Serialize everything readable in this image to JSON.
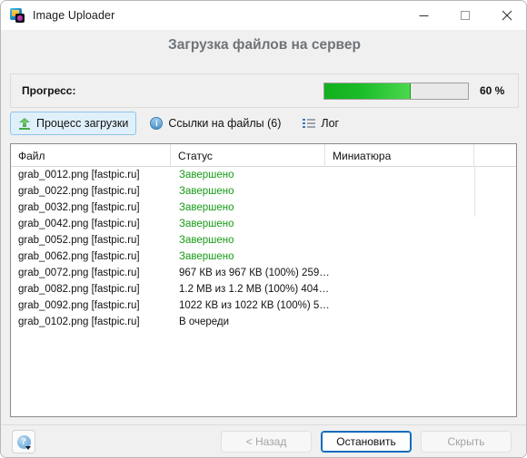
{
  "window": {
    "title": "Image Uploader",
    "icon": "app-icon",
    "controls": {
      "minimize": "minimize-icon",
      "maximize": "maximize-icon",
      "close": "close-icon"
    }
  },
  "heading": "Загрузка файлов на сервер",
  "progress": {
    "label": "Прогресс:",
    "percent_text": "60 %",
    "percent_value": 60,
    "fill_color": "#19bb26",
    "track_color": "#e9e9e9"
  },
  "tabs": [
    {
      "label": "Процесс загрузки",
      "icon": "upload-arrow-icon",
      "active": true
    },
    {
      "label": "Ссылки на файлы (6)",
      "icon": "info-circle-icon",
      "active": false
    },
    {
      "label": "Лог",
      "icon": "list-icon",
      "active": false
    }
  ],
  "table": {
    "columns": [
      "Файл",
      "Статус",
      "Миниатюра",
      ""
    ],
    "rows": [
      {
        "file": "grab_0012.png [fastpic.ru]",
        "status": "Завершено",
        "done": true,
        "thumb": ""
      },
      {
        "file": "grab_0022.png [fastpic.ru]",
        "status": "Завершено",
        "done": true,
        "thumb": ""
      },
      {
        "file": "grab_0032.png [fastpic.ru]",
        "status": "Завершено",
        "done": true,
        "thumb": ""
      },
      {
        "file": "grab_0042.png [fastpic.ru]",
        "status": "Завершено",
        "done": true,
        "thumb": ""
      },
      {
        "file": "grab_0052.png [fastpic.ru]",
        "status": "Завершено",
        "done": true,
        "thumb": ""
      },
      {
        "file": "grab_0062.png [fastpic.ru]",
        "status": "Завершено",
        "done": true,
        "thumb": ""
      },
      {
        "file": "grab_0072.png [fastpic.ru]",
        "status": "967 КВ из 967 КВ (100%) 259…",
        "done": false,
        "thumb": ""
      },
      {
        "file": "grab_0082.png [fastpic.ru]",
        "status": "1.2 MB из 1.2 MB (100%) 404…",
        "done": false,
        "thumb": ""
      },
      {
        "file": "grab_0092.png [fastpic.ru]",
        "status": "1022 КВ из 1022 КВ (100%) 5…",
        "done": false,
        "thumb": ""
      },
      {
        "file": "grab_0102.png [fastpic.ru]",
        "status": "В очереди",
        "done": false,
        "thumb": ""
      }
    ]
  },
  "footer": {
    "help_glyph": "?",
    "back_label": "< Назад",
    "stop_label": "Остановить",
    "hide_label": "Скрыть"
  }
}
